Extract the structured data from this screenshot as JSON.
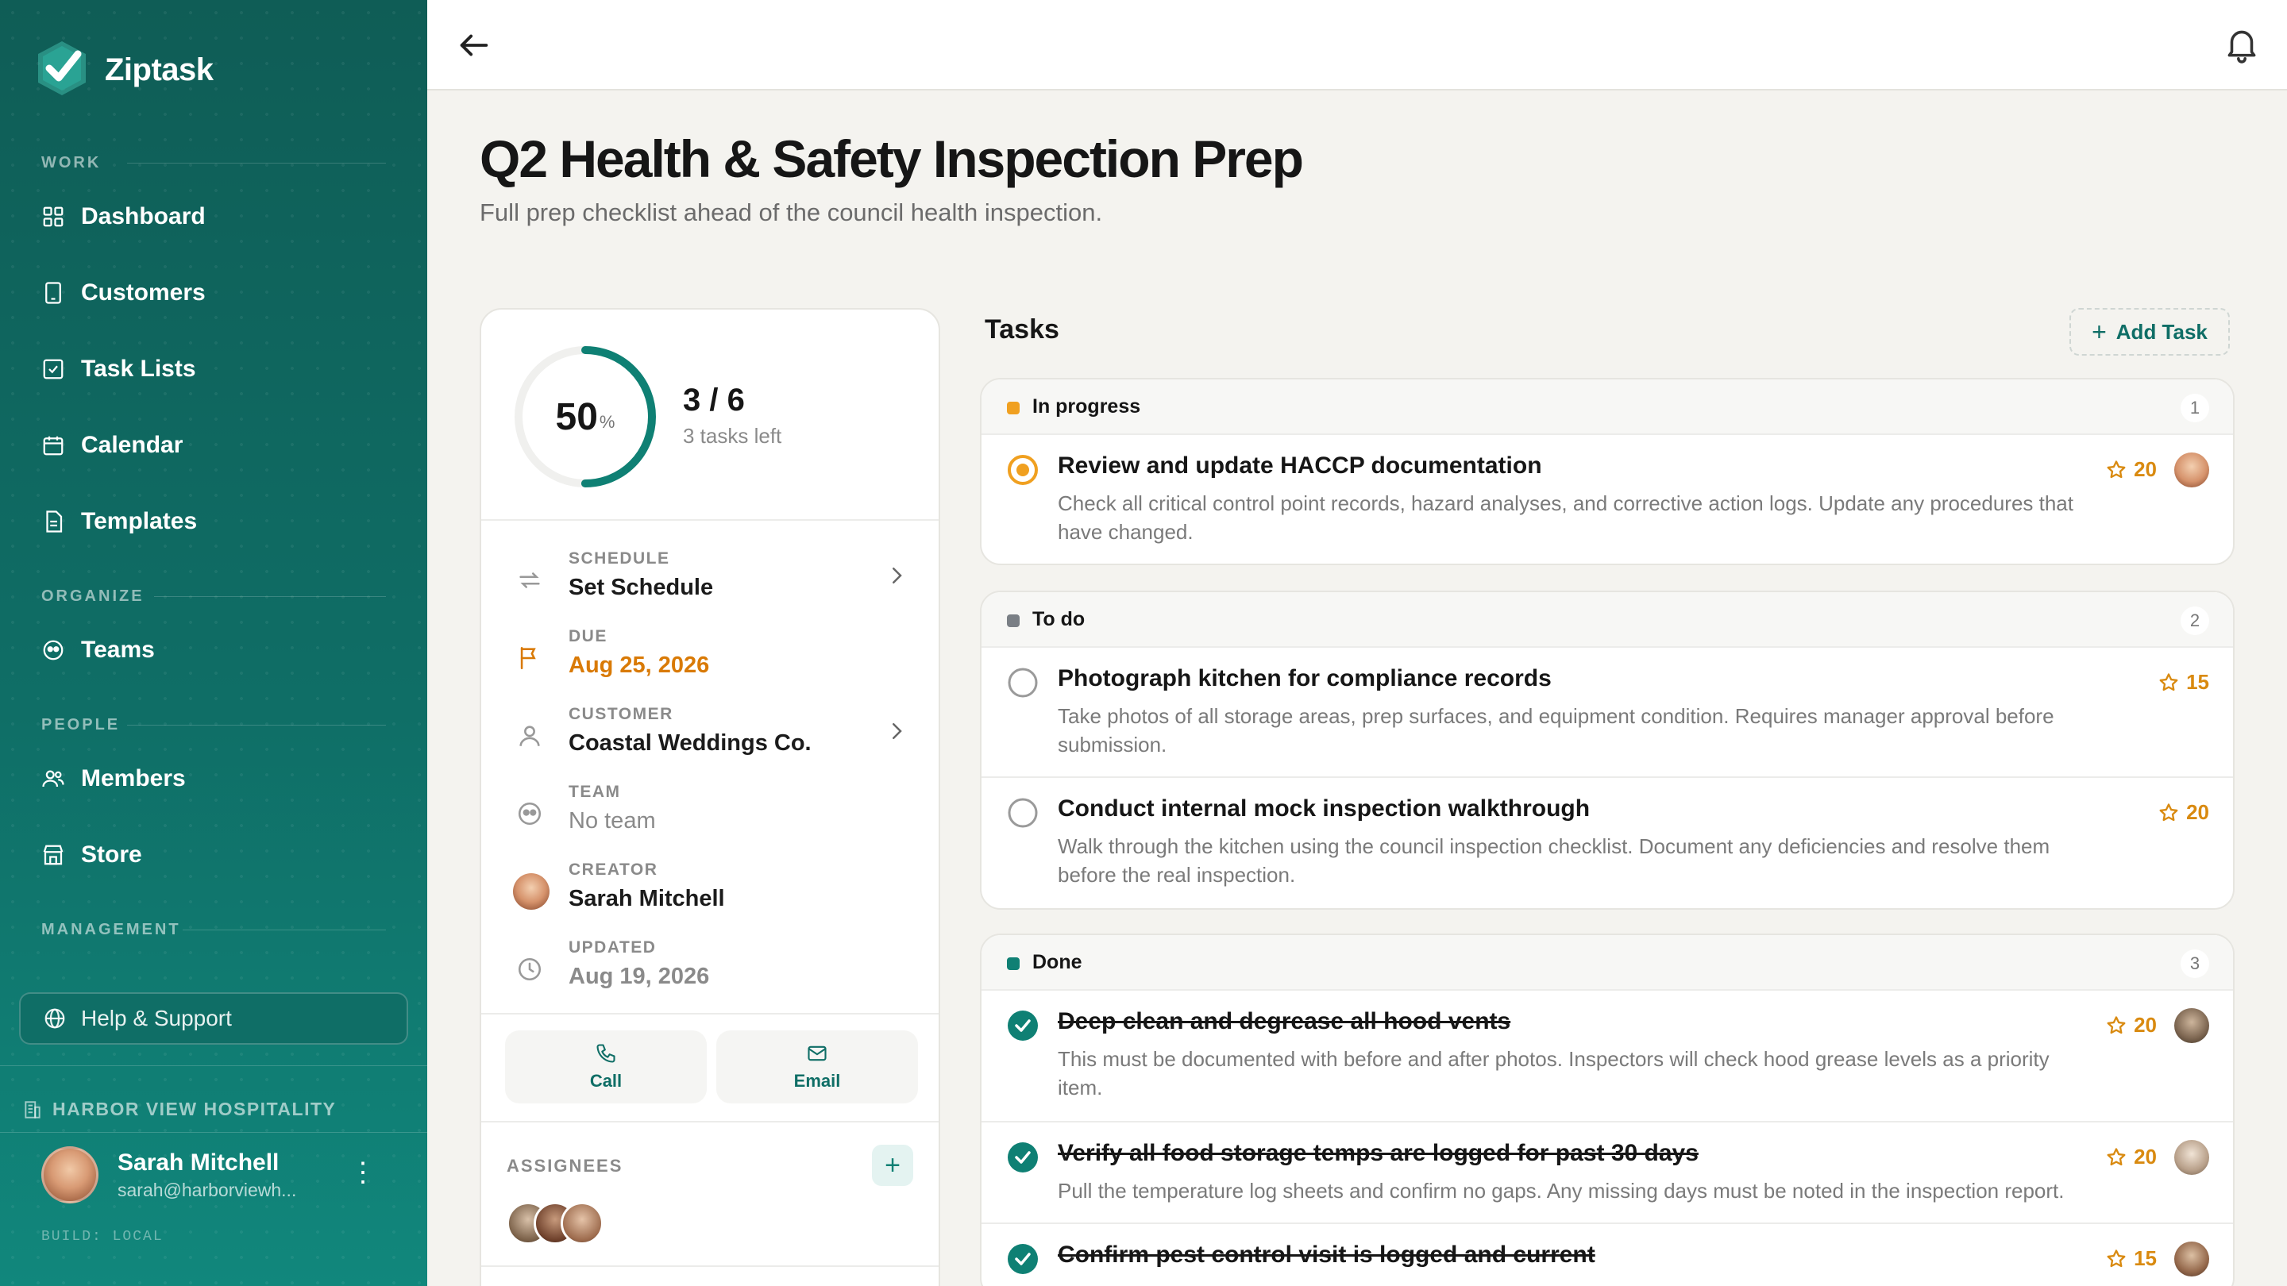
{
  "app": {
    "name": "Ziptask",
    "build": "BUILD: LOCAL"
  },
  "sidebar": {
    "sections": {
      "work": "WORK",
      "organize": "ORGANIZE",
      "people": "PEOPLE",
      "management": "MANAGEMENT"
    },
    "items": [
      {
        "label": "Dashboard",
        "icon": "dashboard-icon"
      },
      {
        "label": "Customers",
        "icon": "customers-icon"
      },
      {
        "label": "Task Lists",
        "icon": "task-lists-icon"
      },
      {
        "label": "Calendar",
        "icon": "calendar-icon"
      },
      {
        "label": "Templates",
        "icon": "templates-icon"
      },
      {
        "label": "Teams",
        "icon": "teams-icon"
      },
      {
        "label": "Members",
        "icon": "members-icon"
      },
      {
        "label": "Store",
        "icon": "store-icon"
      }
    ],
    "help": "Help & Support",
    "organization": "HARBOR VIEW HOSPITALITY",
    "user": {
      "name": "Sarah Mitchell",
      "email": "sarah@harborviewh..."
    }
  },
  "page": {
    "title": "Q2 Health & Safety Inspection Prep",
    "subtitle": "Full prep checklist ahead of the council health inspection."
  },
  "summary": {
    "progress_percent": 50,
    "percent_display": "50",
    "percent_symbol": "%",
    "count": "3 / 6",
    "remaining": "3 tasks left",
    "progress_color": "#0f8074"
  },
  "details": {
    "schedule": {
      "label": "SCHEDULE",
      "value": "Set Schedule"
    },
    "due": {
      "label": "DUE",
      "value": "Aug 25, 2026",
      "color": "#d97a06"
    },
    "customer": {
      "label": "CUSTOMER",
      "value": "Coastal Weddings Co."
    },
    "team": {
      "label": "TEAM",
      "value": "No team"
    },
    "creator": {
      "label": "CREATOR",
      "value": "Sarah Mitchell"
    },
    "updated": {
      "label": "UPDATED",
      "value": "Aug 19, 2026"
    }
  },
  "actions": {
    "call": "Call",
    "email": "Email"
  },
  "assignees": {
    "label": "ASSIGNEES",
    "add": "+"
  },
  "tasks": {
    "title": "Tasks",
    "add_label": "Add Task",
    "groups": [
      {
        "name": "In progress",
        "count": "1",
        "color": "#f0a020",
        "items": [
          {
            "title": "Review and update HACCP documentation",
            "desc": "Check all critical control point records, hazard analyses, and corrective action logs. Update any procedures that have changed.",
            "points": "20",
            "status": "in-progress"
          }
        ]
      },
      {
        "name": "To do",
        "count": "2",
        "color": "#7a7f85",
        "items": [
          {
            "title": "Photograph kitchen for compliance records",
            "desc": "Take photos of all storage areas, prep surfaces, and equipment condition. Requires manager approval before submission.",
            "points": "15",
            "status": "todo"
          },
          {
            "title": "Conduct internal mock inspection walkthrough",
            "desc": "Walk through the kitchen using the council inspection checklist. Document any deficiencies and resolve them before the real inspection.",
            "points": "20",
            "status": "todo"
          }
        ]
      },
      {
        "name": "Done",
        "count": "3",
        "color": "#0f8074",
        "items": [
          {
            "title": "Deep clean and degrease all hood vents",
            "desc": "This must be documented with before and after photos. Inspectors will check hood grease levels as a priority item.",
            "points": "20",
            "status": "done"
          },
          {
            "title": "Verify all food storage temps are logged for past 30 days",
            "desc": "Pull the temperature log sheets and confirm no gaps. Any missing days must be noted in the inspection report.",
            "points": "20",
            "status": "done"
          },
          {
            "title": "Confirm pest control visit is logged and current",
            "desc": "",
            "points": "15",
            "status": "done"
          }
        ]
      }
    ]
  }
}
